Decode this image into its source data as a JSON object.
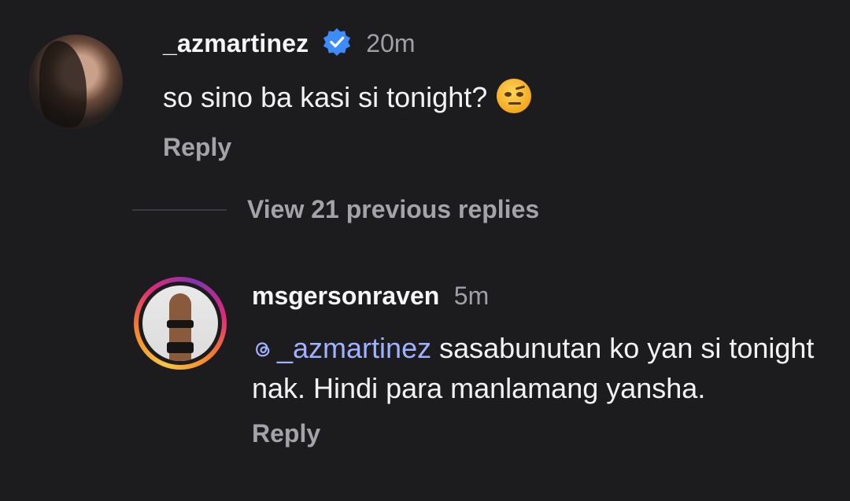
{
  "comment1": {
    "username": "_azmartinez",
    "time": "20m",
    "text": "so sino ba kasi si tonight?",
    "emoji_icon": "raised-eyebrow-emoji",
    "reply_label": "Reply"
  },
  "thread": {
    "view_replies_label": "View 21 previous replies"
  },
  "comment2": {
    "username": "msgersonraven",
    "time": "5m",
    "mention": "_azmartinez",
    "text": " sasabunutan ko yan si tonight nak. Hindi para manlamang yansha.",
    "reply_label": "Reply"
  },
  "colors": {
    "background": "#1c1c1e",
    "verified": "#3d8bfd",
    "mention": "#9fb2ff",
    "muted": "#a4a4a8"
  }
}
